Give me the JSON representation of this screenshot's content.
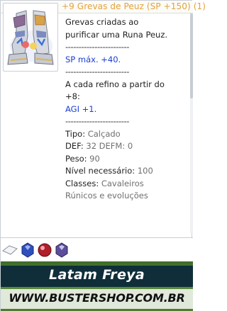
{
  "header": {
    "title": "+9 Grevas de Peuz (SP +150) (1)"
  },
  "item_image": {
    "icon": "boots-icon"
  },
  "description": {
    "lines": [
      "Grevas criadas ao",
      "purificar uma Runa Peuz.",
      "------------------------",
      "SP máx. +40.",
      "------------------------",
      "A cada refino a partir do",
      "+8:",
      "AGI +1.",
      "------------------------"
    ],
    "stats": [
      {
        "label": "Tipo: ",
        "value": "Calçado"
      },
      {
        "label": "DEF: ",
        "value": "32 DEFM: 0"
      },
      {
        "label": "Peso: ",
        "value": "90"
      },
      {
        "label": "Nível necessário: ",
        "value": "100"
      },
      {
        "label": "Classes: ",
        "value": "Cavaleiros"
      }
    ],
    "classes_continued": "Rúnicos e evoluções"
  },
  "card_slots": [
    {
      "icon": "empty-slot-icon"
    },
    {
      "icon": "blue-gem-icon",
      "color": "#2f4fbf"
    },
    {
      "icon": "red-gem-icon",
      "color": "#b01f2a"
    },
    {
      "icon": "purple-gem-icon",
      "color": "#5b4e9c"
    }
  ],
  "banner": {
    "server": "Latam Freya",
    "url": "WWW.BUSTERSHOP.COM.BR"
  },
  "colors": {
    "title": "#e3a23c",
    "highlight": "#1a3ed6",
    "value": "#6f6f6f"
  }
}
